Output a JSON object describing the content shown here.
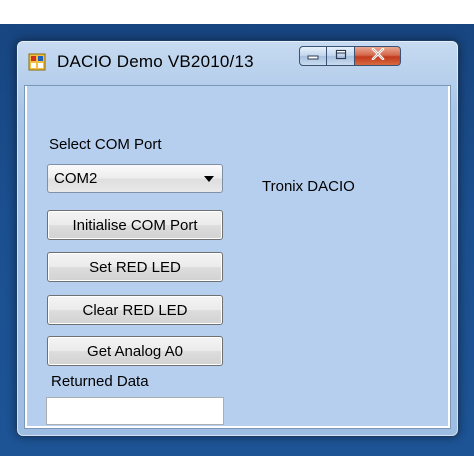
{
  "window": {
    "title": "DACIO Demo VB2010/13"
  },
  "form": {
    "com_port_label": "Select COM Port",
    "com_port_selected": "COM2",
    "device_label": "Tronix DACIO",
    "buttons": {
      "initialise": "Initialise COM Port",
      "set_led": "Set RED LED",
      "clear_led": "Clear RED LED",
      "get_analog": "Get Analog A0"
    },
    "returned_data_label": "Returned Data",
    "returned_data_value": ""
  },
  "icons": {
    "app": "app-form-icon",
    "minimize": "minimize-icon",
    "maximize": "maximize-icon",
    "close": "close-icon",
    "dropdown": "chevron-down-icon"
  },
  "colors": {
    "window_frame": "#a9c5e7",
    "client_background": "#b6cfee",
    "close_button": "#c2391d",
    "desktop": "#1b4f8f"
  }
}
